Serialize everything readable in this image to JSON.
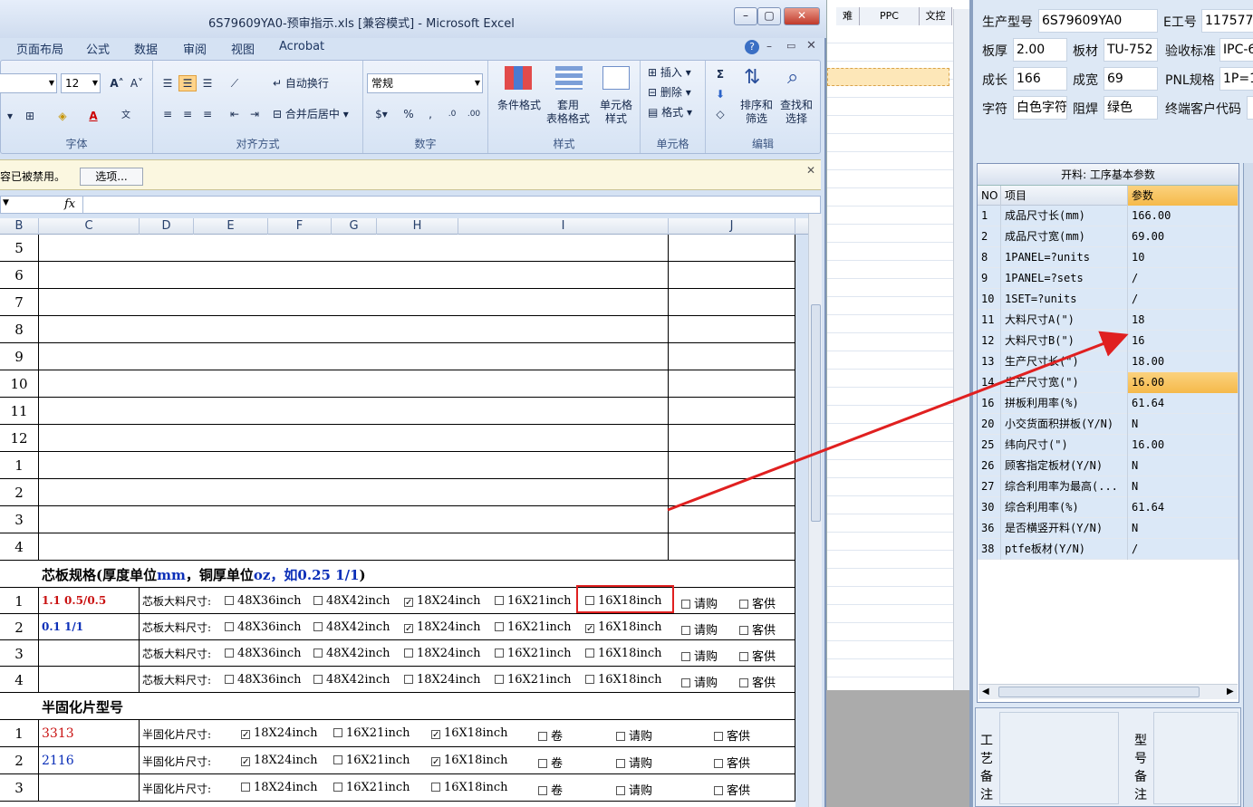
{
  "excel": {
    "title": "6S79609YA0-预审指示.xls  [兼容模式] - Microsoft Excel",
    "ribbon_tabs": [
      "页面布局",
      "公式",
      "数据",
      "审阅",
      "视图",
      "Acrobat"
    ],
    "font_size": "12",
    "number_format": "常规",
    "groups": {
      "font": "字体",
      "align": "对齐方式",
      "number": "数字",
      "styles": "样式",
      "cells": "单元格",
      "edit": "编辑"
    },
    "buttons": {
      "wrap": "自动换行",
      "merge": "合并后居中",
      "cond_format": "条件格式",
      "table_format": "套用\n表格格式",
      "cell_style": "单元格\n样式",
      "insert": "插入",
      "delete": "删除",
      "format": "格式",
      "sort": "排序和\n筛选",
      "find": "查找和\n选择"
    },
    "message_bar": "内容已被禁用。",
    "options_button": "选项...",
    "fx": "fx",
    "columns": [
      "B",
      "C",
      "D",
      "E",
      "F",
      "G",
      "H",
      "I",
      "J"
    ]
  },
  "sheet": {
    "plain_rows": [
      "5",
      "6",
      "7",
      "8",
      "9",
      "10",
      "11",
      "12",
      "1",
      "2",
      "3",
      "4"
    ],
    "core_title": "芯板规格(厚度单位",
    "core_title_mm": "mm",
    "core_title_mid": "，铜厚单位",
    "core_title_oz": "oz",
    "core_title_ex": "，如0.25 1/1",
    "core_title_end": ")",
    "core_label": "芯板大料尺寸:",
    "core_rows": [
      {
        "n": "1",
        "spec": "1.1 0.5/0.5",
        "checks": [
          false,
          false,
          true,
          false,
          false,
          false,
          false
        ]
      },
      {
        "n": "2",
        "spec": "0.1 1/1",
        "checks": [
          false,
          false,
          true,
          false,
          true,
          false,
          false
        ]
      },
      {
        "n": "3",
        "spec": "",
        "checks": [
          false,
          false,
          false,
          false,
          false,
          false,
          false
        ]
      },
      {
        "n": "4",
        "spec": "",
        "checks": [
          false,
          false,
          false,
          false,
          false,
          false,
          false
        ]
      }
    ],
    "core_opts": [
      "48X36inch",
      "48X42inch",
      "18X24inch",
      "16X21inch",
      "16X18inch",
      "请购",
      "客供"
    ],
    "pp_title": "半固化片型号",
    "pp_label": "半固化片尺寸:",
    "pp_rows": [
      {
        "n": "1",
        "type": "3313",
        "checks": [
          true,
          false,
          true,
          false,
          false,
          false
        ]
      },
      {
        "n": "2",
        "type": "2116",
        "checks": [
          true,
          false,
          true,
          false,
          false,
          false
        ]
      },
      {
        "n": "3",
        "type": "",
        "checks": [
          false,
          false,
          false,
          false,
          false,
          false
        ]
      }
    ],
    "pp_opts": [
      "18X24inch",
      "16X21inch",
      "16X18inch",
      "卷",
      "请购",
      "客供"
    ]
  },
  "bgapp": {
    "headers": [
      "难",
      "PPC",
      "文控"
    ]
  },
  "rpanel": {
    "fields": {
      "model_lbl": "生产型号",
      "model": "6S79609YA0",
      "eno_lbl": "E工号",
      "eno": "117577",
      "thick_lbl": "板厚",
      "thick": "2.00",
      "mat_lbl": "板材",
      "mat": "TU-752",
      "std_lbl": "验收标准",
      "std": "IPC-6",
      "len_lbl": "成长",
      "len": "166",
      "wid_lbl": "成宽",
      "wid": "69",
      "pnl_lbl": "PNL规格",
      "pnl": "1P=1",
      "char_lbl": "字符",
      "char": "白色字符",
      "mask_lbl": "阻焊",
      "mask": "绿色",
      "cust_lbl": "终端客户代码",
      "cust": ""
    },
    "table_title": "开料: 工序基本参数",
    "table_headers": [
      "NO",
      "项目",
      "参数"
    ],
    "rows": [
      [
        "1",
        "成品尺寸长(mm)",
        "166.00"
      ],
      [
        "2",
        "成品尺寸宽(mm)",
        "69.00"
      ],
      [
        "8",
        "1PANEL=?units",
        "10"
      ],
      [
        "9",
        "1PANEL=?sets",
        "/"
      ],
      [
        "10",
        "1SET=?units",
        "/"
      ],
      [
        "11",
        "大料尺寸A(\")",
        "18"
      ],
      [
        "12",
        "大料尺寸B(\")",
        "16"
      ],
      [
        "13",
        "生产尺寸长(\")",
        "18.00"
      ],
      [
        "14",
        "生产尺寸宽(\")",
        "16.00"
      ],
      [
        "16",
        "拼板利用率(%)",
        "61.64"
      ],
      [
        "20",
        "小交货面积拼板(Y/N)",
        "N"
      ],
      [
        "25",
        "纬向尺寸(\")",
        "16.00"
      ],
      [
        "26",
        "顾客指定板材(Y/N)",
        "N"
      ],
      [
        "27",
        "综合利用率为最高(...",
        "N"
      ],
      [
        "30",
        "综合利用率(%)",
        "61.64"
      ],
      [
        "36",
        "是否横竖开料(Y/N)",
        "N"
      ],
      [
        "38",
        "ptfe板材(Y/N)",
        "/"
      ]
    ],
    "highlight_row": 8,
    "notes_left": "工艺备注",
    "notes_right": "型号备注"
  },
  "colors": {
    "accent": "#f5b94a",
    "arrow": "#e02020",
    "blue_text": "#0b2fb8",
    "red_text": "#c91111"
  }
}
